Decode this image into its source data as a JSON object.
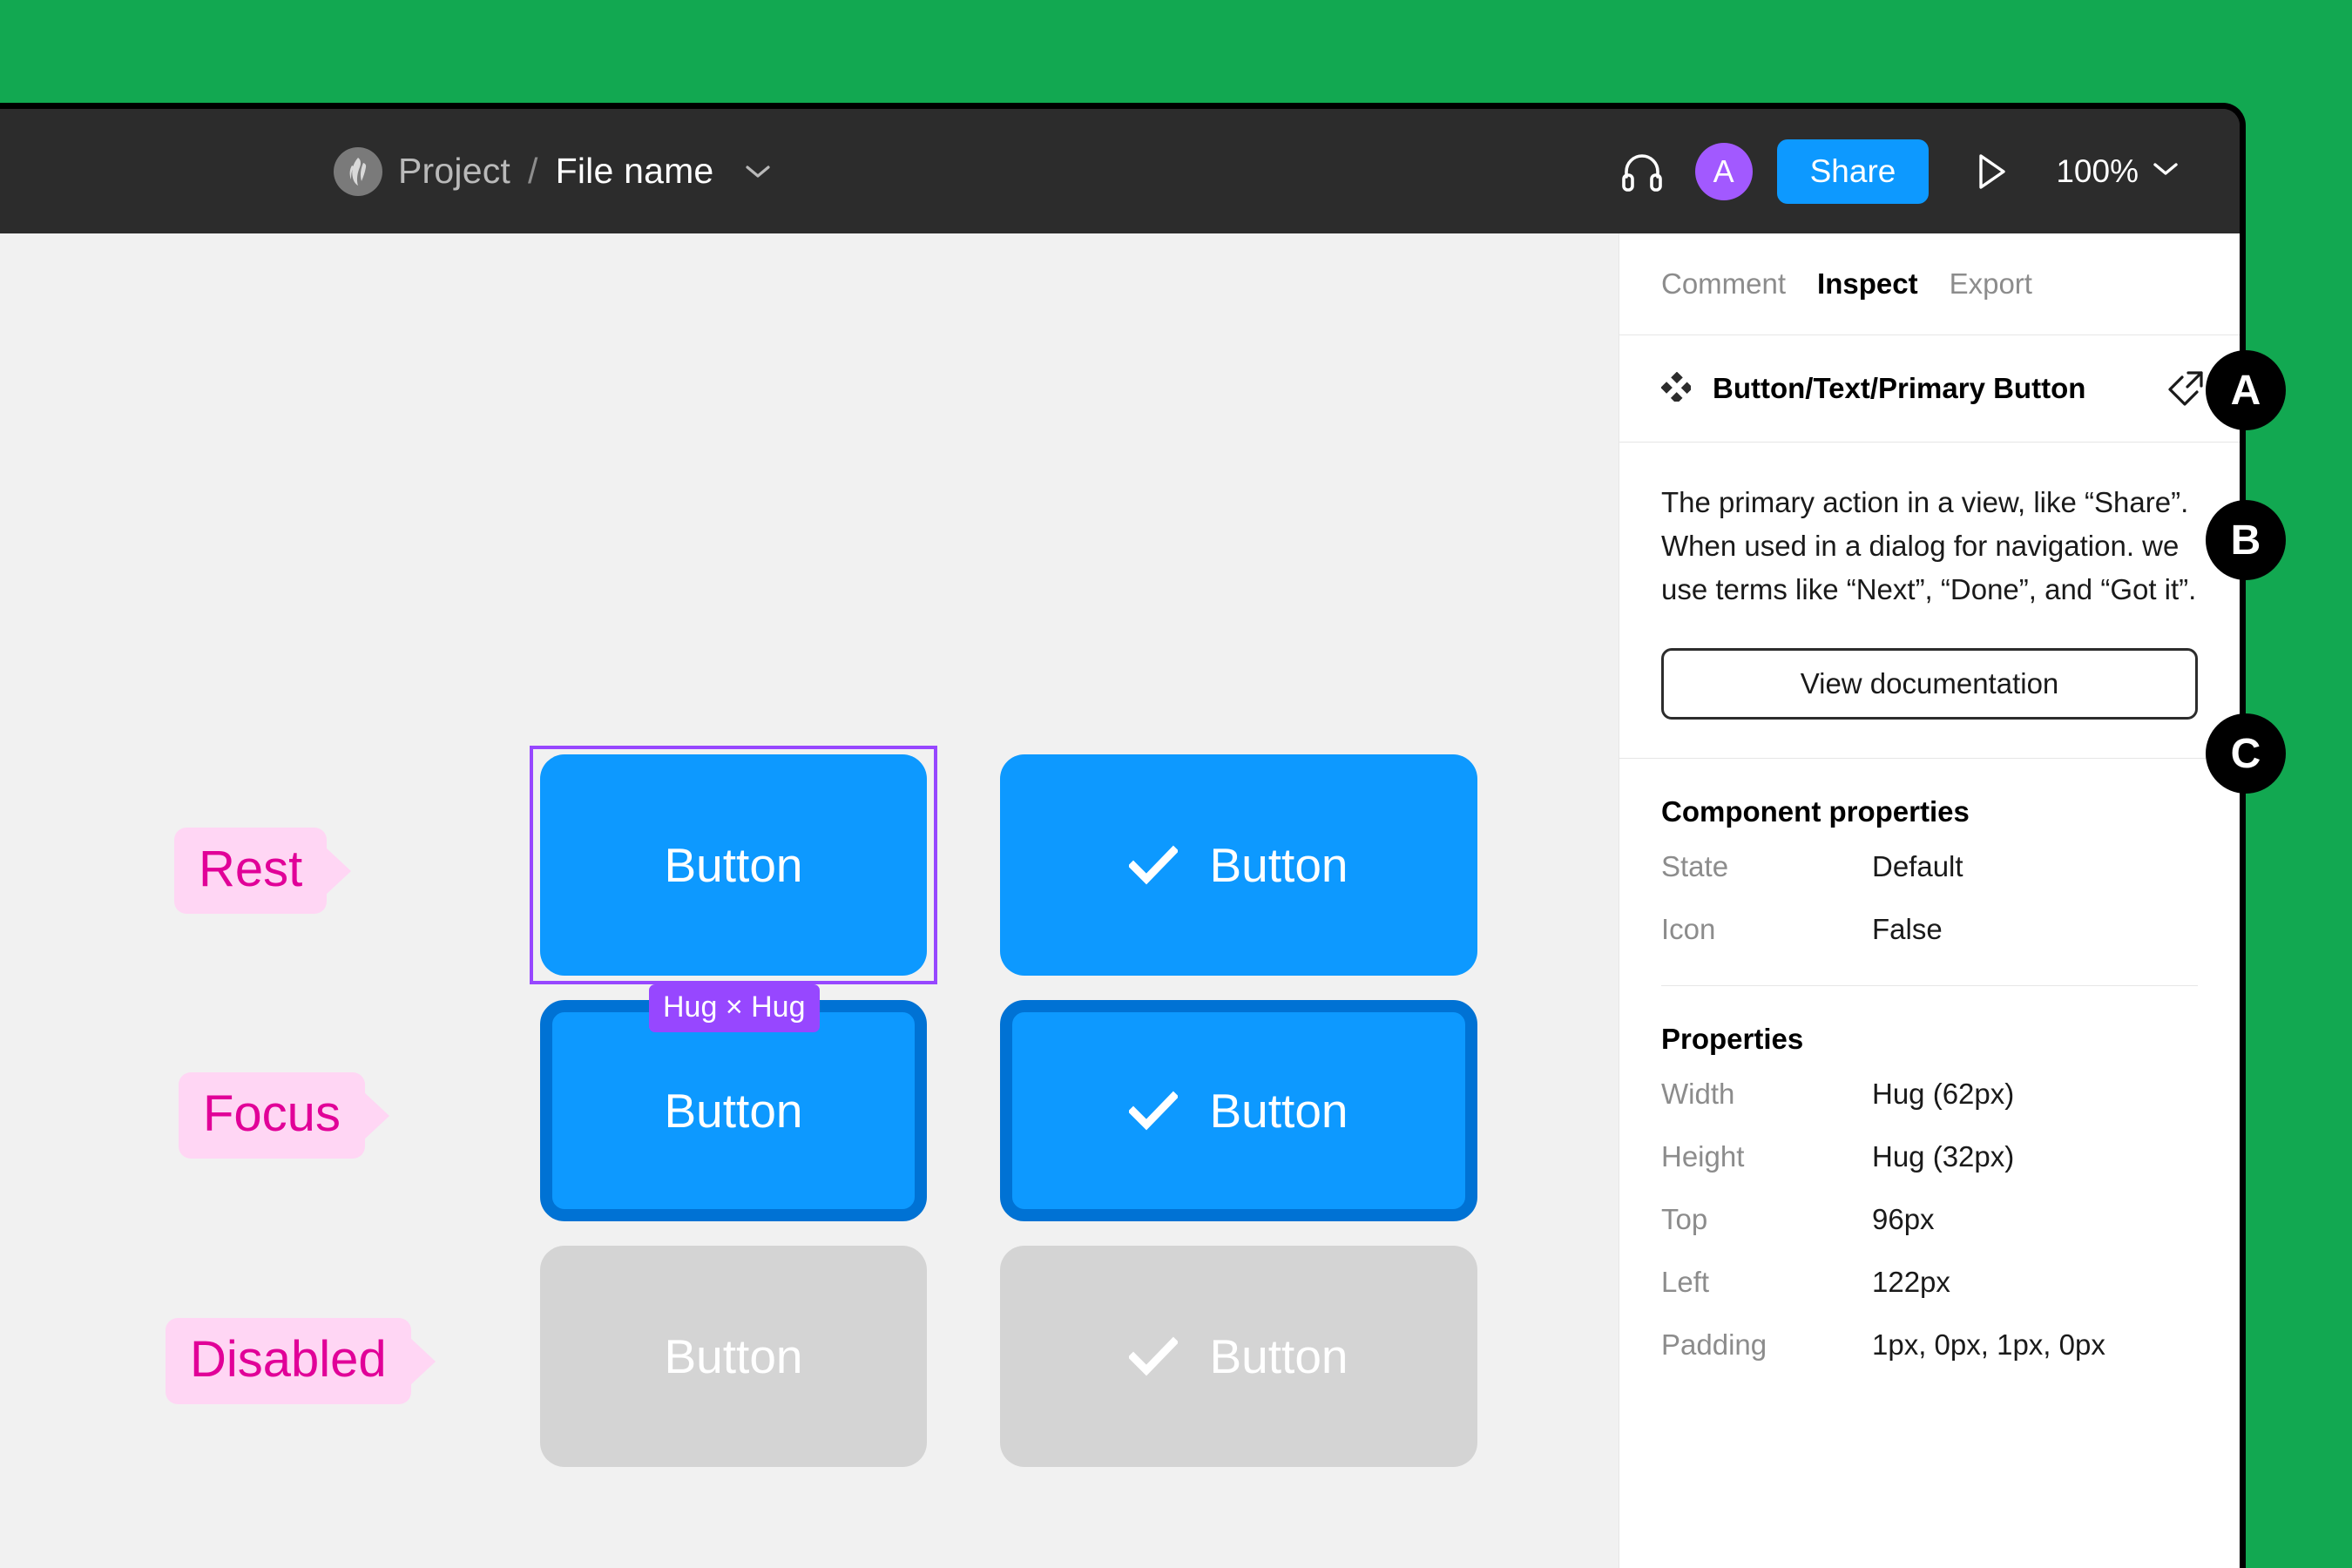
{
  "window": {
    "accent_blue": "#0d99ff",
    "focus_border": "#0072d4",
    "disabled_gray": "#d4d4d4",
    "selection_purple": "#9747ff",
    "backdrop_green": "#12a851",
    "label_pink_bg": "#ffd6f4",
    "label_pink_text": "#e10098"
  },
  "toolbar": {
    "project_label": "Project",
    "separator": "/",
    "file_name": "File name",
    "file_menu_icon": "chevron-down-icon",
    "logo_icon": "app-logo-icon",
    "headset_icon": "headset-icon",
    "avatar_initial": "A",
    "share_label": "Share",
    "present_icon": "play-icon",
    "zoom_level": "100%",
    "zoom_chevron_icon": "chevron-down-icon"
  },
  "canvas": {
    "state_labels": [
      {
        "text": "Rest"
      },
      {
        "text": "Focus"
      },
      {
        "text": "Disabled"
      }
    ],
    "buttons": [
      {
        "state": "Rest",
        "label": "Button",
        "icon": false
      },
      {
        "state": "Rest",
        "label": "Button",
        "icon": true
      },
      {
        "state": "Focus",
        "label": "Button",
        "icon": false
      },
      {
        "state": "Focus",
        "label": "Button",
        "icon": true
      },
      {
        "state": "Disabled",
        "label": "Button",
        "icon": false
      },
      {
        "state": "Disabled",
        "label": "Button",
        "icon": true
      }
    ],
    "size_badge": "Hug × Hug",
    "check_icon": "check-icon"
  },
  "panel": {
    "tabs": [
      {
        "label": "Comment",
        "active": false
      },
      {
        "label": "Inspect",
        "active": true
      },
      {
        "label": "Export",
        "active": false
      }
    ],
    "component": {
      "icon": "component-diamond-icon",
      "name": "Button/Text/Primary Button",
      "goto_icon": "go-to-main-component-icon"
    },
    "description": "The primary action in a view, like “Share”. When used in a dialog for navigation. we use terms like “Next”, “Done”, and “Got it”.",
    "view_documentation_label": "View documentation",
    "component_properties": {
      "title": "Component properties",
      "rows": [
        {
          "key": "State",
          "value": "Default"
        },
        {
          "key": "Icon",
          "value": "False"
        }
      ]
    },
    "properties": {
      "title": "Properties",
      "rows": [
        {
          "key": "Width",
          "value": "Hug (62px)"
        },
        {
          "key": "Height",
          "value": "Hug (32px)"
        },
        {
          "key": "Top",
          "value": "96px"
        },
        {
          "key": "Left",
          "value": "122px"
        },
        {
          "key": "Padding",
          "value": "1px, 0px, 1px, 0px"
        }
      ]
    }
  },
  "callouts": [
    {
      "letter": "A"
    },
    {
      "letter": "B"
    },
    {
      "letter": "C"
    }
  ]
}
